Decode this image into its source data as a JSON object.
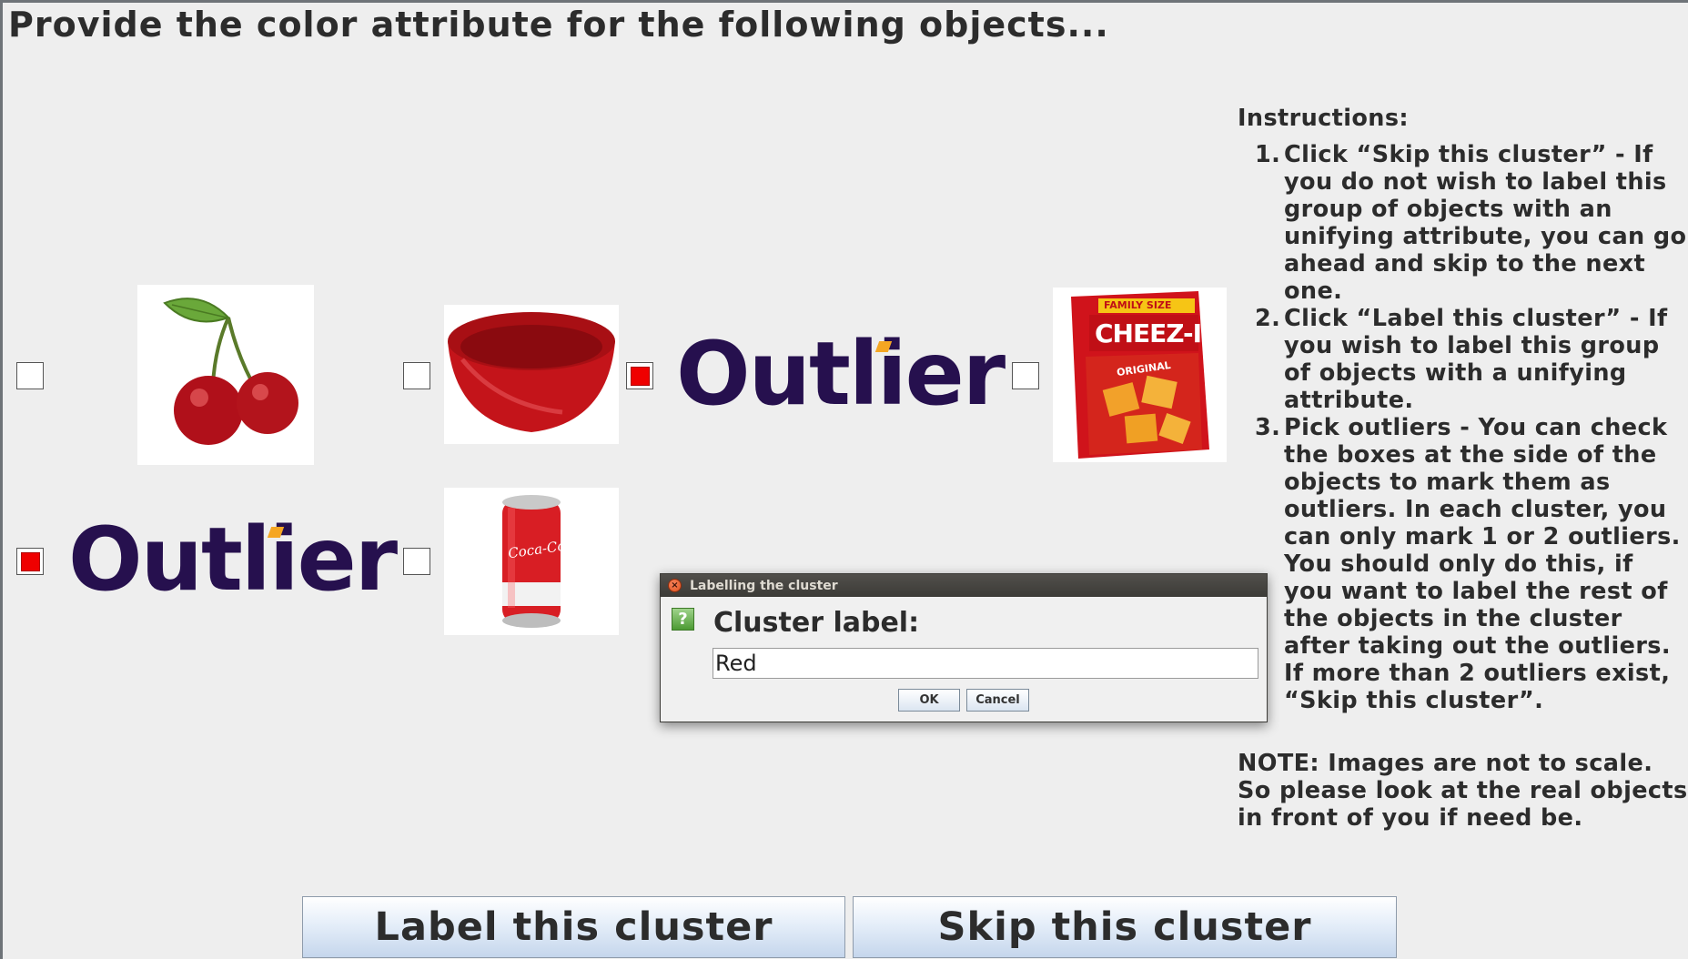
{
  "title": "Provide the color attribute for the following objects...",
  "objects": [
    {
      "name": "cherries",
      "checked": false
    },
    {
      "name": "red-bowl",
      "checked": false
    },
    {
      "name": "outlier-1",
      "checked": true,
      "text": "Outlier"
    },
    {
      "name": "cheez-it-box",
      "checked": false,
      "box_text_top": "FAMILY SIZE",
      "box_brand": "CHEEZ-IT",
      "box_sub": "ORIGINAL"
    },
    {
      "name": "outlier-2",
      "checked": true,
      "text": "Outlier"
    },
    {
      "name": "coca-cola-can",
      "checked": false,
      "can_brand": "Coca-Cola"
    }
  ],
  "instructions": {
    "heading": "Instructions:",
    "items": [
      {
        "num": "1.",
        "text": "Click “Skip this cluster” - If you do not wish to label this group of objects with an unifying attribute, you can go ahead and skip to the next one."
      },
      {
        "num": "2.",
        "text": "Click “Label this cluster” - If you wish to label this group of objects with a unifying attribute."
      },
      {
        "num": "3.",
        "text": "Pick outliers - You can check the boxes at the side of the objects to mark them as outliers. In each cluster, you can only mark 1 or 2 outliers. You should only do this, if you want to label the rest of the objects in the cluster after taking out the outliers. If more than 2 outliers exist, “Skip this cluster”."
      }
    ],
    "note": "NOTE: Images are not to scale. So please look at the real objects in front of you if need be."
  },
  "buttons": {
    "label_cluster": "Label this cluster",
    "skip_cluster": "Skip this cluster"
  },
  "dialog": {
    "title": "Labelling the cluster",
    "prompt": "Cluster label:",
    "input_value": "Red",
    "ok": "OK",
    "cancel": "Cancel",
    "question_glyph": "?"
  },
  "colors": {
    "checked": "#ef0000",
    "outlier_text": "#26104e",
    "outlier_accent": "#f5a623"
  }
}
